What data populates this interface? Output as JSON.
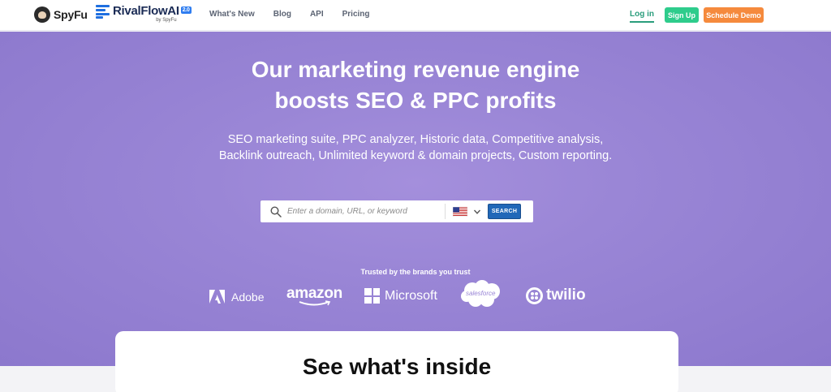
{
  "header": {
    "brand": "SpyFu",
    "product": "RivalFlowAI",
    "product_version": "2.0",
    "product_by": "by SpyFu",
    "nav": [
      "What's New",
      "Blog",
      "API",
      "Pricing"
    ],
    "login_label": "Log in",
    "signup_label": "Sign Up",
    "demo_label": "Schedule Demo"
  },
  "hero": {
    "title_line1": "Our marketing revenue engine",
    "title_line2": "boosts SEO & PPC profits",
    "subtitle": "SEO marketing suite, PPC analyzer, Historic data, Competitive analysis, Backlink outreach, Unlimited keyword & domain projects, Custom reporting."
  },
  "search": {
    "placeholder": "Enter a domain, URL, or keyword",
    "country": "US",
    "button_label": "SEARCH"
  },
  "trust": {
    "label": "Trusted by the brands you trust",
    "brands": [
      "Adobe",
      "amazon",
      "Microsoft",
      "salesforce",
      "twilio"
    ]
  },
  "section": {
    "title": "See what's inside"
  },
  "colors": {
    "hero_bg": "#9a86d6",
    "signup": "#2ecc8c",
    "demo": "#f58a3d",
    "search_button": "#2168b8",
    "login": "#2a9d7c"
  }
}
